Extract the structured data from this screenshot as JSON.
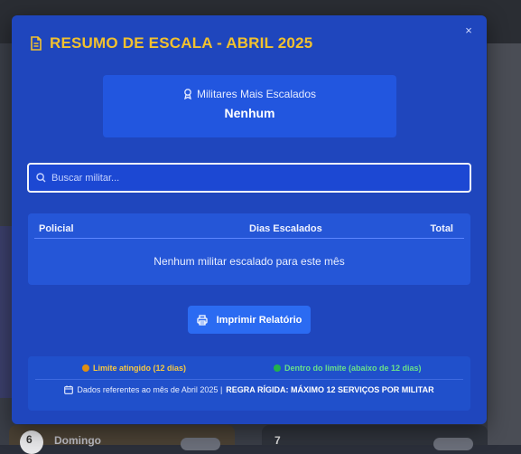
{
  "modal": {
    "title": "RESUMO DE ESCALA - ABRIL 2025",
    "close_label": "×"
  },
  "stats": {
    "label": "Militares Mais Escalados",
    "value": "Nenhum"
  },
  "search": {
    "placeholder": "Buscar militar..."
  },
  "table": {
    "headers": [
      "Policial",
      "Dias Escalados",
      "Total"
    ],
    "empty_message": "Nenhum militar escalado para este mês"
  },
  "actions": {
    "print_label": "Imprimir Relatório"
  },
  "legend": {
    "limit_reached": "Limite atingido (12 dias)",
    "within_limit": "Dentro do limite (abaixo de 12 dias)"
  },
  "footer": {
    "note": "Dados referentes ao mês de Abril 2025 |",
    "rule": "REGRA RÍGIDA: MÁXIMO 12 SERVIÇOS POR MILITAR"
  },
  "background": {
    "day_label": "Domingo",
    "day_number": "6",
    "day_number_right": "7"
  },
  "colors": {
    "accent_title": "#f2c12e",
    "modal_bg": "#1f46bd",
    "limit_dot": "#e08f12",
    "within_dot": "#22b24c"
  },
  "icons": {
    "title": "document-icon",
    "stats": "award-icon",
    "search": "search-icon",
    "print": "printer-icon",
    "footer": "calendar-icon",
    "close": "close-icon"
  }
}
